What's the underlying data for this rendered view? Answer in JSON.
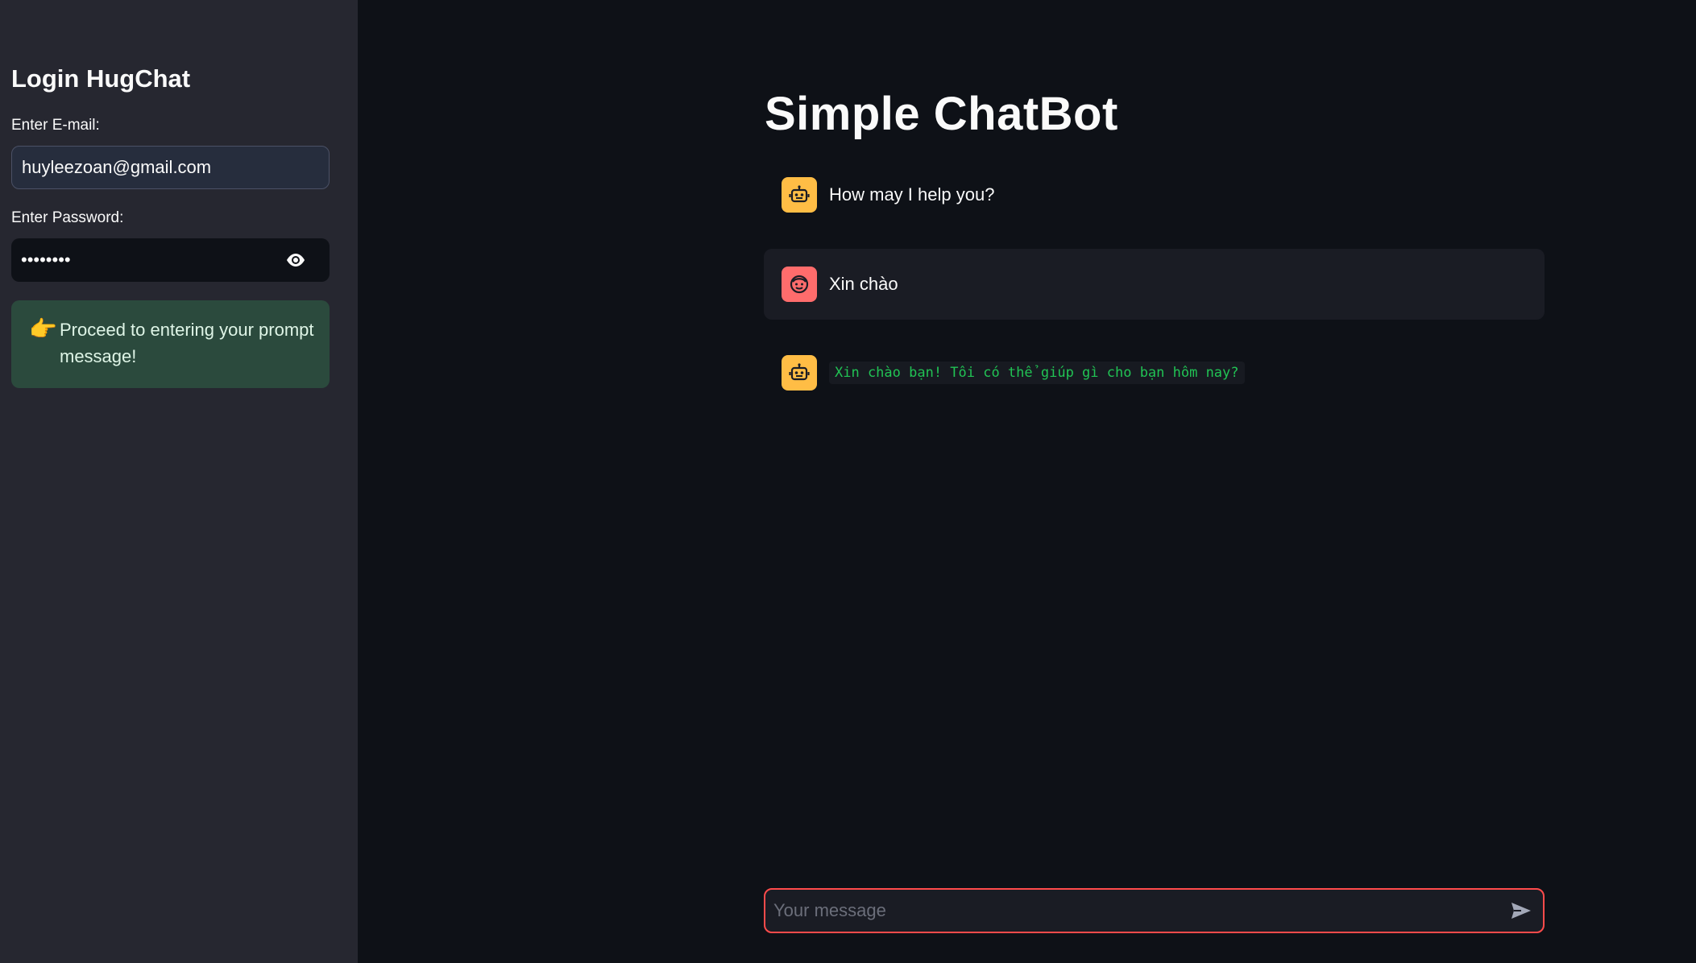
{
  "sidebar": {
    "title": "Login HugChat",
    "email_label": "Enter E-mail:",
    "email_value": "huyleezoan@gmail.com",
    "password_label": "Enter Password:",
    "password_value": "••••••••",
    "password_toggle_icon": "eye-icon",
    "success_emoji": "👉",
    "success_message": "Proceed to entering your prompt message!"
  },
  "main": {
    "title": "Simple ChatBot",
    "messages": [
      {
        "role": "assistant",
        "avatar": "robot-icon",
        "text": "How may I help you?"
      },
      {
        "role": "user",
        "avatar": "face-icon",
        "text": "Xin chào"
      },
      {
        "role": "assistant",
        "avatar": "robot-icon",
        "text": "Xin chào bạn! Tôi có thể giúp gì cho bạn hôm nay?"
      }
    ],
    "chat_input": {
      "placeholder": "Your message",
      "send_icon": "send-icon"
    }
  },
  "colors": {
    "background": "#0e1117",
    "sidebar": "#262730",
    "bot_avatar": "#ffbd45",
    "user_avatar": "#ff6c6c",
    "accent": "#ff4b4b",
    "success_bg": "#2b4a3d",
    "code_text": "#21c354"
  }
}
